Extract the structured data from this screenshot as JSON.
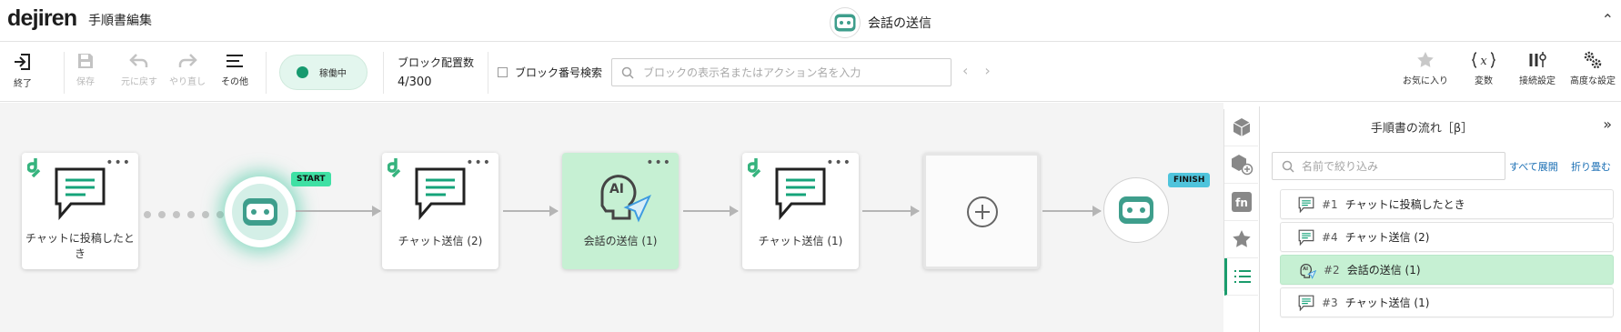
{
  "header": {
    "logo": "dejiren",
    "title": "手順書編集",
    "center_title": "会話の送信"
  },
  "toolbar": {
    "exit_label": "終了",
    "save_label": "保存",
    "undo_label": "元に戻す",
    "redo_label": "やり直し",
    "other_label": "その他",
    "status_label": "稼働中",
    "block_count_label": "ブロック配置数",
    "block_count_value": "4/300",
    "block_number_search_label": "ブロック番号検索",
    "search_placeholder": "ブロックの表示名またはアクション名を入力",
    "favorites_label": "お気に入り",
    "variables_label": "変数",
    "connection_label": "接続設定",
    "advanced_label": "高度な設定"
  },
  "canvas": {
    "start_flag": "START",
    "finish_flag": "FINISH",
    "nodes": [
      {
        "label": "チャットに投稿したと\nき",
        "kind": "chat",
        "state": "normal"
      },
      {
        "label": "チャット送信 (2)",
        "kind": "chat",
        "state": "normal"
      },
      {
        "label": "会話の送信 (1)",
        "kind": "ai",
        "state": "active"
      },
      {
        "label": "チャット送信 (1)",
        "kind": "chat",
        "state": "normal"
      },
      {
        "label": "",
        "kind": "empty",
        "state": "empty"
      }
    ]
  },
  "panel": {
    "title": "手順書の流れ［β］",
    "filter_placeholder": "名前で絞り込み",
    "expand_all": "すべて展開",
    "collapse": "折り畳む",
    "items": [
      {
        "num": "#1",
        "name": "チャットに投稿したとき",
        "icon": "chat-icon",
        "active": false
      },
      {
        "num": "#4",
        "name": "チャット送信 (2)",
        "icon": "chat-icon",
        "active": false
      },
      {
        "num": "#2",
        "name": "会話の送信 (1)",
        "icon": "ai-icon",
        "active": true
      },
      {
        "num": "#3",
        "name": "チャット送信 (1)",
        "icon": "chat-icon",
        "active": false
      }
    ]
  },
  "colors": {
    "brand_green": "#1a9c6c",
    "active_node": "#c6f0d3",
    "start_flag": "#3fe0a4",
    "finish_flag": "#4fc4dc",
    "robot_teal": "#3e9e8c"
  }
}
